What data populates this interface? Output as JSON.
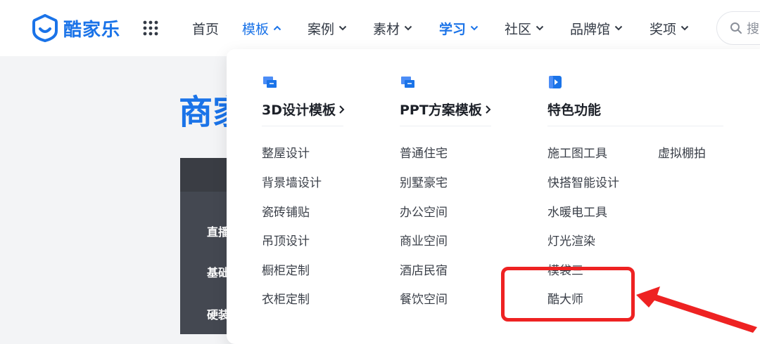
{
  "brand": {
    "name": "酷家乐",
    "color": "#1a73e8"
  },
  "nav": {
    "items": [
      {
        "label": "首页",
        "has_dropdown": false
      },
      {
        "label": "模板",
        "has_dropdown": true,
        "expanded": true
      },
      {
        "label": "案例",
        "has_dropdown": true
      },
      {
        "label": "素材",
        "has_dropdown": true
      },
      {
        "label": "学习",
        "has_dropdown": true
      },
      {
        "label": "社区",
        "has_dropdown": true
      },
      {
        "label": "品牌馆",
        "has_dropdown": true
      },
      {
        "label": "奖项",
        "has_dropdown": true
      }
    ],
    "search_placeholder": "搜"
  },
  "background": {
    "title_fragment": "商家",
    "rows": [
      "直播",
      "基础",
      "硬装"
    ]
  },
  "dropdown": {
    "columns": [
      {
        "icon": "template-3d-icon",
        "heading": "3D设计模板",
        "items": [
          "整屋设计",
          "背景墙设计",
          "瓷砖铺贴",
          "吊顶设计",
          "橱柜定制",
          "衣柜定制"
        ]
      },
      {
        "icon": "template-ppt-icon",
        "heading": "PPT方案模板",
        "items": [
          "普通住宅",
          "别墅豪宅",
          "办公空间",
          "商业空间",
          "酒店民宿",
          "餐饮空间"
        ]
      },
      {
        "icon": "feature-play-icon",
        "heading": "特色功能",
        "items": [
          "施工图工具",
          "快搭智能设计",
          "水暖电工具",
          "灯光渲染",
          "模袋三",
          "酷大师"
        ]
      }
    ],
    "extra_item": "虚拟棚拍"
  },
  "annotation": {
    "color": "#ee2222"
  }
}
